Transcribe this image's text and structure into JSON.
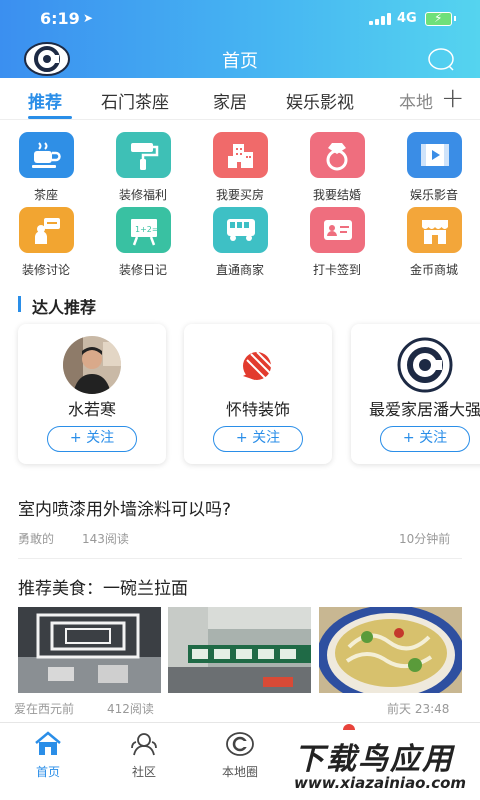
{
  "status_bar": {
    "time": "6:19",
    "network": "4G"
  },
  "header": {
    "title": "首页"
  },
  "tabs": [
    {
      "label": "推荐"
    },
    {
      "label": "石门茶座"
    },
    {
      "label": "家居"
    },
    {
      "label": "娱乐影视"
    },
    {
      "label": "本地"
    }
  ],
  "categories": [
    {
      "label": "茶座",
      "icon": "tea-cup-icon",
      "color": "#2f8fe6"
    },
    {
      "label": "装修福利",
      "icon": "paint-roller-icon",
      "color": "#3ec0b6"
    },
    {
      "label": "我要买房",
      "icon": "building-icon",
      "color": "#f06a6a"
    },
    {
      "label": "我要结婚",
      "icon": "ring-icon",
      "color": "#ef6e7e"
    },
    {
      "label": "娱乐影音",
      "icon": "video-icon",
      "color": "#3a8de6"
    },
    {
      "label": "装修讨论",
      "icon": "discussion-icon",
      "color": "#f2a531"
    },
    {
      "label": "装修日记",
      "icon": "blackboard-icon",
      "color": "#39c1a2"
    },
    {
      "label": "直通商家",
      "icon": "bus-icon",
      "color": "#3ec0c5"
    },
    {
      "label": "打卡签到",
      "icon": "id-card-icon",
      "color": "#ef6e7e"
    },
    {
      "label": "金币商城",
      "icon": "shop-icon",
      "color": "#f3a63a"
    }
  ],
  "experts": {
    "title": "达人推荐",
    "follow_label": "+ 关注",
    "cards": [
      {
        "name": "水若寒"
      },
      {
        "name": "怀特装饰"
      },
      {
        "name": "最爱家居潘大强"
      }
    ]
  },
  "article1": {
    "title": "室内喷漆用外墙涂料可以吗?",
    "author": "勇敢的",
    "reads": "143阅读",
    "time": "10分钟前"
  },
  "article2": {
    "title": "推荐美食：一碗兰拉面",
    "author": "爱在西元前",
    "reads": "412阅读",
    "time": "前天 23:48"
  },
  "bottom_nav": [
    {
      "label": "首页",
      "icon": "home-icon"
    },
    {
      "label": "社区",
      "icon": "community-icon"
    },
    {
      "label": "本地圈",
      "icon": "local-circle-icon"
    }
  ],
  "watermark": {
    "line1": "下载鸟应用",
    "line2": "www.xiazainiao.com"
  },
  "colors": {
    "accent": "#2a8ee8",
    "header_start": "#3b8ff0",
    "header_end": "#55d4ef"
  }
}
